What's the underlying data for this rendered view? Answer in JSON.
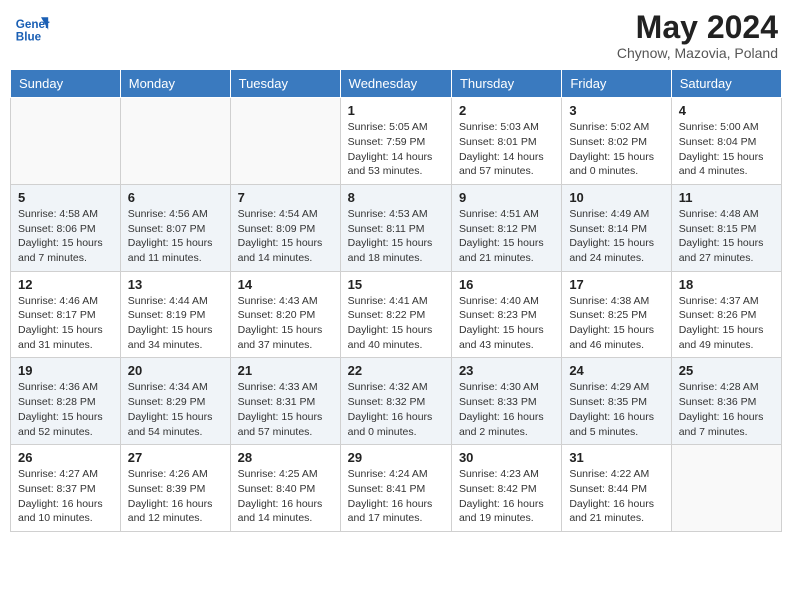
{
  "header": {
    "logo": {
      "line1": "General",
      "line2": "Blue"
    },
    "title": "May 2024",
    "location": "Chynow, Mazovia, Poland"
  },
  "days_of_week": [
    "Sunday",
    "Monday",
    "Tuesday",
    "Wednesday",
    "Thursday",
    "Friday",
    "Saturday"
  ],
  "weeks": [
    [
      {
        "day": "",
        "sunrise": "",
        "sunset": "",
        "daylight": ""
      },
      {
        "day": "",
        "sunrise": "",
        "sunset": "",
        "daylight": ""
      },
      {
        "day": "",
        "sunrise": "",
        "sunset": "",
        "daylight": ""
      },
      {
        "day": "1",
        "sunrise": "Sunrise: 5:05 AM",
        "sunset": "Sunset: 7:59 PM",
        "daylight": "Daylight: 14 hours and 53 minutes."
      },
      {
        "day": "2",
        "sunrise": "Sunrise: 5:03 AM",
        "sunset": "Sunset: 8:01 PM",
        "daylight": "Daylight: 14 hours and 57 minutes."
      },
      {
        "day": "3",
        "sunrise": "Sunrise: 5:02 AM",
        "sunset": "Sunset: 8:02 PM",
        "daylight": "Daylight: 15 hours and 0 minutes."
      },
      {
        "day": "4",
        "sunrise": "Sunrise: 5:00 AM",
        "sunset": "Sunset: 8:04 PM",
        "daylight": "Daylight: 15 hours and 4 minutes."
      }
    ],
    [
      {
        "day": "5",
        "sunrise": "Sunrise: 4:58 AM",
        "sunset": "Sunset: 8:06 PM",
        "daylight": "Daylight: 15 hours and 7 minutes."
      },
      {
        "day": "6",
        "sunrise": "Sunrise: 4:56 AM",
        "sunset": "Sunset: 8:07 PM",
        "daylight": "Daylight: 15 hours and 11 minutes."
      },
      {
        "day": "7",
        "sunrise": "Sunrise: 4:54 AM",
        "sunset": "Sunset: 8:09 PM",
        "daylight": "Daylight: 15 hours and 14 minutes."
      },
      {
        "day": "8",
        "sunrise": "Sunrise: 4:53 AM",
        "sunset": "Sunset: 8:11 PM",
        "daylight": "Daylight: 15 hours and 18 minutes."
      },
      {
        "day": "9",
        "sunrise": "Sunrise: 4:51 AM",
        "sunset": "Sunset: 8:12 PM",
        "daylight": "Daylight: 15 hours and 21 minutes."
      },
      {
        "day": "10",
        "sunrise": "Sunrise: 4:49 AM",
        "sunset": "Sunset: 8:14 PM",
        "daylight": "Daylight: 15 hours and 24 minutes."
      },
      {
        "day": "11",
        "sunrise": "Sunrise: 4:48 AM",
        "sunset": "Sunset: 8:15 PM",
        "daylight": "Daylight: 15 hours and 27 minutes."
      }
    ],
    [
      {
        "day": "12",
        "sunrise": "Sunrise: 4:46 AM",
        "sunset": "Sunset: 8:17 PM",
        "daylight": "Daylight: 15 hours and 31 minutes."
      },
      {
        "day": "13",
        "sunrise": "Sunrise: 4:44 AM",
        "sunset": "Sunset: 8:19 PM",
        "daylight": "Daylight: 15 hours and 34 minutes."
      },
      {
        "day": "14",
        "sunrise": "Sunrise: 4:43 AM",
        "sunset": "Sunset: 8:20 PM",
        "daylight": "Daylight: 15 hours and 37 minutes."
      },
      {
        "day": "15",
        "sunrise": "Sunrise: 4:41 AM",
        "sunset": "Sunset: 8:22 PM",
        "daylight": "Daylight: 15 hours and 40 minutes."
      },
      {
        "day": "16",
        "sunrise": "Sunrise: 4:40 AM",
        "sunset": "Sunset: 8:23 PM",
        "daylight": "Daylight: 15 hours and 43 minutes."
      },
      {
        "day": "17",
        "sunrise": "Sunrise: 4:38 AM",
        "sunset": "Sunset: 8:25 PM",
        "daylight": "Daylight: 15 hours and 46 minutes."
      },
      {
        "day": "18",
        "sunrise": "Sunrise: 4:37 AM",
        "sunset": "Sunset: 8:26 PM",
        "daylight": "Daylight: 15 hours and 49 minutes."
      }
    ],
    [
      {
        "day": "19",
        "sunrise": "Sunrise: 4:36 AM",
        "sunset": "Sunset: 8:28 PM",
        "daylight": "Daylight: 15 hours and 52 minutes."
      },
      {
        "day": "20",
        "sunrise": "Sunrise: 4:34 AM",
        "sunset": "Sunset: 8:29 PM",
        "daylight": "Daylight: 15 hours and 54 minutes."
      },
      {
        "day": "21",
        "sunrise": "Sunrise: 4:33 AM",
        "sunset": "Sunset: 8:31 PM",
        "daylight": "Daylight: 15 hours and 57 minutes."
      },
      {
        "day": "22",
        "sunrise": "Sunrise: 4:32 AM",
        "sunset": "Sunset: 8:32 PM",
        "daylight": "Daylight: 16 hours and 0 minutes."
      },
      {
        "day": "23",
        "sunrise": "Sunrise: 4:30 AM",
        "sunset": "Sunset: 8:33 PM",
        "daylight": "Daylight: 16 hours and 2 minutes."
      },
      {
        "day": "24",
        "sunrise": "Sunrise: 4:29 AM",
        "sunset": "Sunset: 8:35 PM",
        "daylight": "Daylight: 16 hours and 5 minutes."
      },
      {
        "day": "25",
        "sunrise": "Sunrise: 4:28 AM",
        "sunset": "Sunset: 8:36 PM",
        "daylight": "Daylight: 16 hours and 7 minutes."
      }
    ],
    [
      {
        "day": "26",
        "sunrise": "Sunrise: 4:27 AM",
        "sunset": "Sunset: 8:37 PM",
        "daylight": "Daylight: 16 hours and 10 minutes."
      },
      {
        "day": "27",
        "sunrise": "Sunrise: 4:26 AM",
        "sunset": "Sunset: 8:39 PM",
        "daylight": "Daylight: 16 hours and 12 minutes."
      },
      {
        "day": "28",
        "sunrise": "Sunrise: 4:25 AM",
        "sunset": "Sunset: 8:40 PM",
        "daylight": "Daylight: 16 hours and 14 minutes."
      },
      {
        "day": "29",
        "sunrise": "Sunrise: 4:24 AM",
        "sunset": "Sunset: 8:41 PM",
        "daylight": "Daylight: 16 hours and 17 minutes."
      },
      {
        "day": "30",
        "sunrise": "Sunrise: 4:23 AM",
        "sunset": "Sunset: 8:42 PM",
        "daylight": "Daylight: 16 hours and 19 minutes."
      },
      {
        "day": "31",
        "sunrise": "Sunrise: 4:22 AM",
        "sunset": "Sunset: 8:44 PM",
        "daylight": "Daylight: 16 hours and 21 minutes."
      },
      {
        "day": "",
        "sunrise": "",
        "sunset": "",
        "daylight": ""
      }
    ]
  ]
}
